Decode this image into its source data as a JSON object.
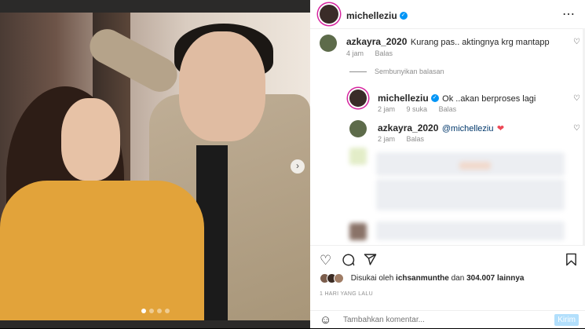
{
  "post": {
    "author": "michelleziu",
    "more_icon": "⋯",
    "verified_icon": "✓"
  },
  "comments": [
    {
      "user": "azkayra_2020",
      "text": "Kurang pas.. aktingnya krg mantapp",
      "time": "4 jam",
      "reply": "Balas"
    }
  ],
  "hide_replies": "Sembunyikan balasan",
  "replies": [
    {
      "user": "michelleziu",
      "text": "Ok ..akan berproses lagi",
      "time": "2 jam",
      "likes": "9 suka",
      "reply": "Balas"
    },
    {
      "user": "azkayra_2020",
      "mention": "@michelleziu",
      "heart": "❤",
      "time": "2 jam",
      "reply": "Balas"
    }
  ],
  "likes": {
    "prefix": "Disukai oleh",
    "user": "ichsanmunthe",
    "middle": "dan",
    "count": "304.007 lainnya"
  },
  "date": "1 HARI YANG LALU",
  "add_comment": {
    "placeholder": "Tambahkan komentar...",
    "post_label": "Kirim"
  },
  "colors": {
    "accent": "#0095f6",
    "heart": "#ed4956"
  }
}
